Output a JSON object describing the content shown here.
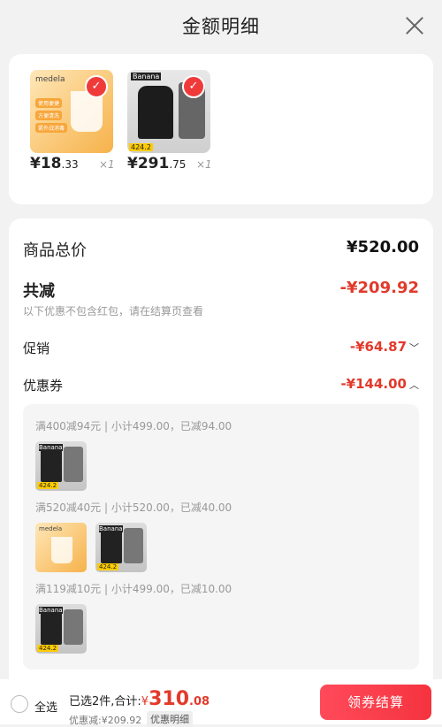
{
  "header": {
    "title": "金额明细"
  },
  "products": [
    {
      "brand": "medela",
      "price_main": "¥18",
      "price_small": ".33",
      "qty": "×1",
      "bullets": [
        "使用便捷",
        "方便清洗",
        "紧外战消毒"
      ]
    },
    {
      "brand": "Banana",
      "price_main": "¥291",
      "price_small": ".75",
      "qty": "×1",
      "tag": "424.2"
    }
  ],
  "summary": {
    "goods_total_label": "商品总价",
    "goods_total_value": "¥520.00",
    "total_discount_label": "共减",
    "total_discount_value": "-¥209.92",
    "note": "以下优惠不包含红包，请在结算页查看",
    "promo_label": "促销",
    "promo_value": "-¥64.87",
    "coupon_label": "优惠券",
    "coupon_value": "-¥144.00"
  },
  "coupons": [
    {
      "text": "满400减94元 | 小计499.00，已减94.00"
    },
    {
      "text": "满520减40元 | 小计520.00，已减40.00"
    },
    {
      "text": "满119减10元 | 小计499.00，已减10.00"
    }
  ],
  "footer": {
    "select_all": "全选",
    "selected_text": "已选2件,合计:",
    "currency": "¥",
    "total_big": "310",
    "total_dec": ".08",
    "discount_text": "优惠减:¥209.92",
    "detail_tag": "优惠明细",
    "pay_button": "领券结算"
  },
  "colors": {
    "accent": "#e23a2b",
    "pay_button": "#f5333f"
  }
}
